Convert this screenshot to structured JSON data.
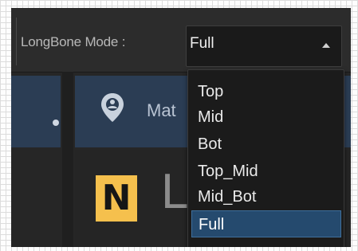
{
  "toolbar": {
    "mode_label": "LongBone Mode :",
    "select": {
      "value": "Full",
      "caret_icon": "caret-up-icon"
    }
  },
  "tab": {
    "icon": "map-pin-icon",
    "label": "Mat"
  },
  "content": {
    "badge": "N",
    "title_partial": "L"
  },
  "dropdown": {
    "options": [
      "Top",
      "Mid",
      "Bot",
      "Top_Mid",
      "Mid_Bot",
      "Full"
    ],
    "selected_index": 5
  },
  "colors": {
    "background": "#262626",
    "tab_bar": "#2b3d54",
    "selected_item": "#254a6e",
    "badge": "#f5c04d"
  }
}
